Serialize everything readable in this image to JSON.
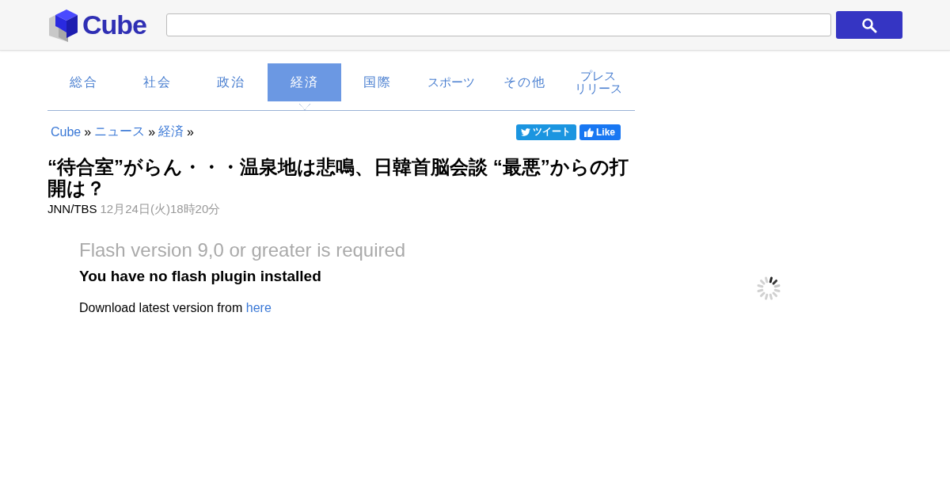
{
  "header": {
    "logo_text": "Cube"
  },
  "tabs": [
    {
      "lines": [
        "総合"
      ],
      "selected": false
    },
    {
      "lines": [
        "社会"
      ],
      "selected": false
    },
    {
      "lines": [
        "政治"
      ],
      "selected": false
    },
    {
      "lines": [
        "経済"
      ],
      "selected": true
    },
    {
      "lines": [
        "国際"
      ],
      "selected": false
    },
    {
      "lines": [
        "スポーツ"
      ],
      "selected": false
    },
    {
      "lines": [
        "その他"
      ],
      "selected": false
    },
    {
      "lines": [
        "プレス",
        "リリース"
      ],
      "selected": false
    }
  ],
  "breadcrumb": [
    {
      "label": "Cube"
    },
    {
      "label": "ニュース"
    },
    {
      "label": "経済"
    }
  ],
  "breadcrumb_separator": "»",
  "share_buttons": [
    {
      "kind": "tweet",
      "label": "ツイート"
    },
    {
      "kind": "like",
      "label": "Like"
    }
  ],
  "article": {
    "title": "“待合室”がらん・・・温泉地は悲鳴、日韓首脳会談 “最悪”からの打開は？",
    "source": "JNN/TBS",
    "date": "12月24日(火)18時20分"
  },
  "flash": {
    "heading": "Flash version 9,0 or greater is required",
    "subheading": "You have no flash plugin installed",
    "download_text": "Download latest version from",
    "download_link": "here"
  }
}
